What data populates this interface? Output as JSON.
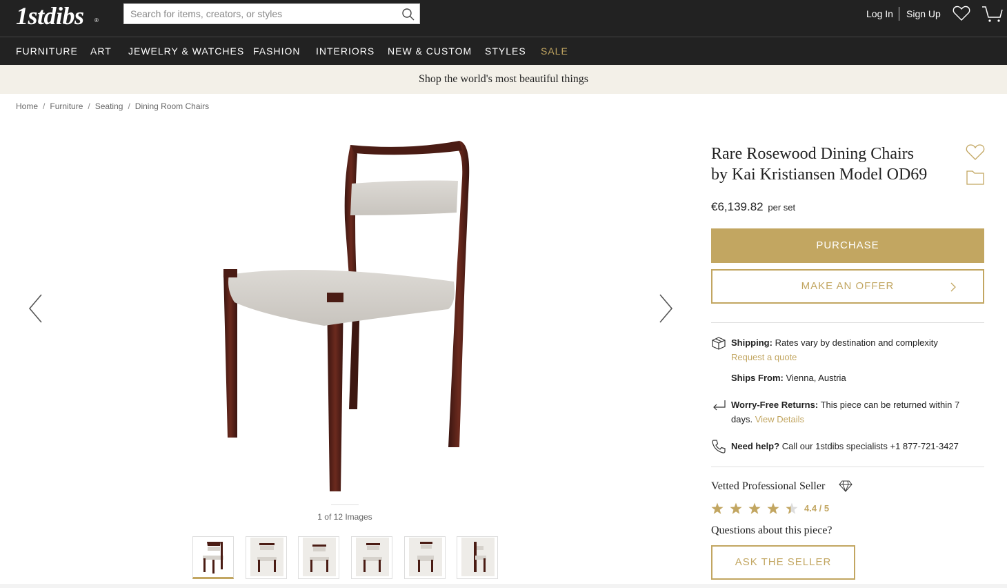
{
  "header": {
    "logo_text": "1stdibs",
    "logo_mark": "®",
    "search_placeholder": "Search for items, creators, or styles",
    "login_label": "Log In",
    "signup_label": "Sign Up"
  },
  "nav": {
    "items": [
      "FURNITURE",
      "ART",
      "JEWELRY & WATCHES",
      "FASHION",
      "INTERIORS",
      "NEW & CUSTOM",
      "STYLES",
      "SALE"
    ]
  },
  "promo": {
    "text": "Shop the world's most beautiful things"
  },
  "breadcrumb": [
    "Home",
    "Furniture",
    "Seating",
    "Dining Room Chairs"
  ],
  "gallery": {
    "counter": "1 of 12 Images",
    "thumbnail_count": 6,
    "selected_index": 0
  },
  "product": {
    "title_line1": "Rare Rosewood Dining Chairs",
    "title_line2": "by Kai Kristiansen Model OD69",
    "price": "€6,139.82",
    "price_unit": "per set",
    "purchase_label": "PURCHASE",
    "offer_label": "MAKE AN OFFER"
  },
  "info": {
    "shipping_label": "Shipping:",
    "shipping_text": "Rates vary by destination and complexity",
    "shipping_link": "Request a quote",
    "ships_from_label": "Ships From:",
    "ships_from_text": "Vienna, Austria",
    "returns_label": "Worry-Free Returns:",
    "returns_text": "This piece can be returned within 7",
    "returns_text2": "days.",
    "returns_link": "View Details",
    "help_label": "Need help?",
    "help_text": "Call our 1stdibs specialists +1 877-721-3427"
  },
  "seller": {
    "title": "Vetted Professional Seller",
    "rating_value": 4.4,
    "rating_text": "4.4 / 5",
    "questions_text": "Questions about this piece?",
    "ask_label": "ASK THE SELLER"
  },
  "colors": {
    "brand_dark": "#222222",
    "gold": "#c2a661",
    "promo_bg": "#f3f0e8"
  }
}
